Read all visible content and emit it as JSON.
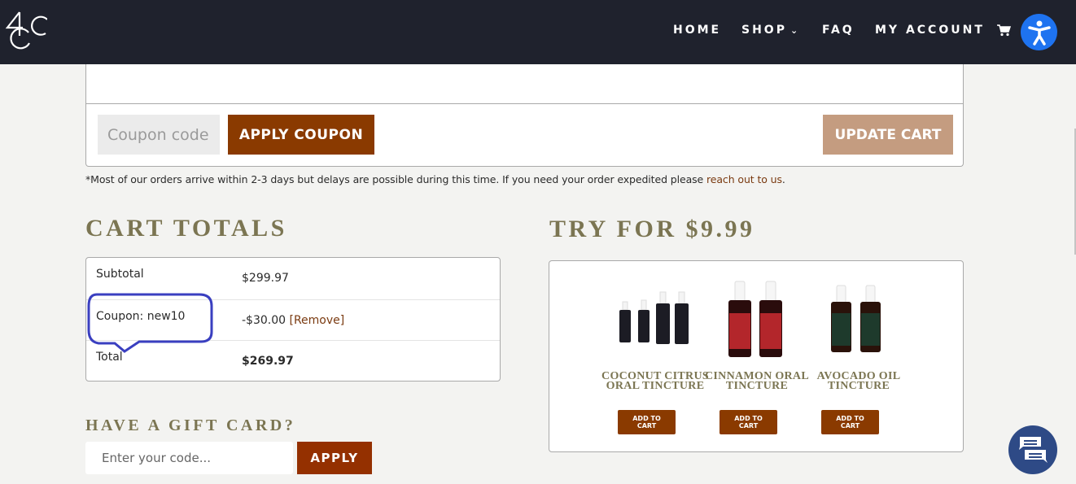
{
  "header": {
    "logo_alt": "4C",
    "nav": [
      {
        "label": "HOME"
      },
      {
        "label": "SHOP",
        "has_dropdown": true
      },
      {
        "label": "FAQ"
      },
      {
        "label": "MY ACCOUNT"
      }
    ],
    "cart_icon": "cart-icon",
    "accessibility_icon": "accessibility-icon"
  },
  "cart_actions": {
    "coupon_placeholder": "Coupon code",
    "coupon_value": "",
    "apply_coupon_label": "APPLY COUPON",
    "update_cart_label": "UPDATE CART"
  },
  "notice": {
    "text": "*Most of our orders arrive within 2-3 days but delays are possible during this time. If you need your order expedited please ",
    "link_text": "reach out to us",
    "suffix": "."
  },
  "cart_totals": {
    "title": "CART TOTALS",
    "rows": [
      {
        "label": "Subtotal",
        "value": "$299.97"
      },
      {
        "label": "Coupon: new10",
        "value": "-$30.00",
        "action": "[Remove]"
      },
      {
        "label": "Total",
        "value": "$269.97"
      }
    ],
    "annotation_color": "#3a3fc0"
  },
  "gift_card": {
    "title": "HAVE A GIFT CARD?",
    "placeholder": "Enter your code...",
    "apply_label": "APPLY"
  },
  "upsell": {
    "title": "TRY FOR $9.99",
    "products": [
      {
        "name": "COCONUT CITRUS ORAL TINCTURE",
        "button": "ADD TO CART",
        "label_color": "#1c1c24"
      },
      {
        "name": "CINNAMON ORAL TINCTURE",
        "button": "ADD TO CART",
        "label_color": "#b3262b"
      },
      {
        "name": "AVOCADO OIL TINCTURE",
        "button": "ADD TO CART",
        "label_color": "#1e3a2c"
      }
    ]
  },
  "chat": {
    "icon": "chat-icon"
  },
  "colors": {
    "header_bg": "#1f222d",
    "brand_brown": "#8a3a00",
    "update_cart": "#c49c80",
    "heading_olive": "#7b7552",
    "accessibility_blue": "#1e73f0",
    "chat_blue": "#2e4a86"
  }
}
